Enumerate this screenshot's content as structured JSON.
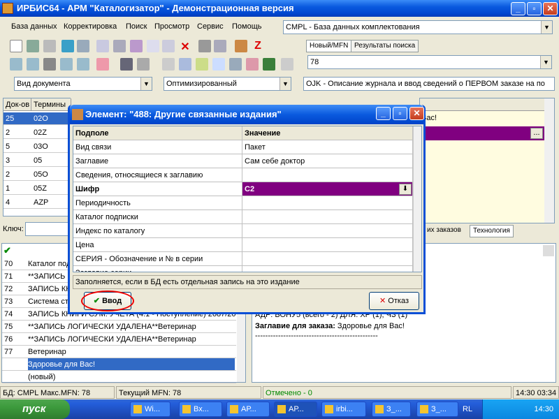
{
  "window": {
    "title": "ИРБИС64 - АРМ \"Каталогизатор\" - Демонстрационная версия",
    "min": "_",
    "max": "▫",
    "close": "✕"
  },
  "menu": [
    "База данных",
    "Корректировка",
    "Поиск",
    "Просмотр",
    "Сервис",
    "Помощь"
  ],
  "db_combo": "CMPL - База данных комплектования",
  "tabs": {
    "mfn": "Новый/MFN",
    "results": "Результаты поиска"
  },
  "mfn_combo": "78",
  "combos": {
    "doc_type": "Вид документа",
    "mode": "Оптимизированный",
    "worksheet": "OJK - Описание журнала и ввод сведений о ПЕРВОМ заказе на по"
  },
  "terms": {
    "col1": "Док-ов",
    "col2": "Термины",
    "rows": [
      {
        "n": "25",
        "t": "02O"
      },
      {
        "n": "2",
        "t": "02Z"
      },
      {
        "n": "5",
        "t": "03O"
      },
      {
        "n": "3",
        "t": "05"
      },
      {
        "n": "2",
        "t": "05O"
      },
      {
        "n": "1",
        "t": "05Z"
      },
      {
        "n": "4",
        "t": "AZP"
      }
    ]
  },
  "key_label": "Ключ:",
  "right_top": {
    "text1": "Вас!",
    "ellipsis": "..."
  },
  "bottom_tabs": {
    "orders": "их заказов",
    "tech": "Технология"
  },
  "records": {
    "rows": [
      {
        "n": "70",
        "t": "Каталог под"
      },
      {
        "n": "71",
        "t": "**ЗАПИСЬ К"
      },
      {
        "n": "72",
        "t": "ЗАПИСЬ КНИ"
      },
      {
        "n": "73",
        "t": "Система ст"
      },
      {
        "n": "74",
        "t": "ЗАПИСЬ КНИГИ СУМ. УЧЕТА (4.1 - Поступление) 2687/20"
      },
      {
        "n": "75",
        "t": "**ЗАПИСЬ ЛОГИЧЕСКИ УДАЛЕНА**Ветеринар"
      },
      {
        "n": "76",
        "t": "**ЗАПИСЬ ЛОГИЧЕСКИ УДАЛЕНА**Ветеринар"
      },
      {
        "n": "77",
        "t": "Ветеринар"
      },
      {
        "n": "78",
        "t": "Здоровье для Вас!"
      },
      {
        "n": "",
        "t": "(новый)"
      }
    ]
  },
  "preview": {
    "line1": "АДР: БОНУ5 (всего - 2)       ДЛЯ: ХР (1), ЧЗ (1)",
    "label": "Заглавие для заказа:",
    "value": " Здоровье для Вас!",
    "sep": "------------------------------------------------"
  },
  "dialog": {
    "title": "Элемент: \"488: Другие связанные издания\"",
    "col_sub": "Подполе",
    "col_val": "Значение",
    "rows": [
      {
        "f": "Вид связи",
        "v": "Пакет"
      },
      {
        "f": "Заглавие",
        "v": "Сам себе доктор"
      },
      {
        "f": "Сведения, относящиеся к заглавию",
        "v": ""
      },
      {
        "f": "Шифр",
        "v": "C2"
      },
      {
        "f": "Периодичность",
        "v": ""
      },
      {
        "f": "Каталог подписки",
        "v": ""
      },
      {
        "f": "Индекс по каталогу",
        "v": ""
      },
      {
        "f": "Цена",
        "v": ""
      },
      {
        "f": "СЕРИЯ - Обозначение и № в серии",
        "v": ""
      },
      {
        "f": "Заглавие серии",
        "v": ""
      }
    ],
    "hint": "Заполняется, если в БД есть отдельная запись на это издание",
    "ok": "Ввод",
    "cancel": "Отказ"
  },
  "status": {
    "db": "БД: CMPL Макс.MFN: 78",
    "cur": "Текущий MFN: 78",
    "marked": "Отмечено - 0",
    "time": "14:30  03:34"
  },
  "taskbar": {
    "start": "пуск",
    "tasks": [
      "Wi...",
      "Вх...",
      "АР...",
      "АР...",
      "irbi...",
      "З_...",
      "З_..."
    ],
    "lang": "RL",
    "clock": "14:30"
  },
  "colors": {
    "purple": "#800080",
    "selection": "#316ac5",
    "titlebar": "#0a5adf"
  }
}
